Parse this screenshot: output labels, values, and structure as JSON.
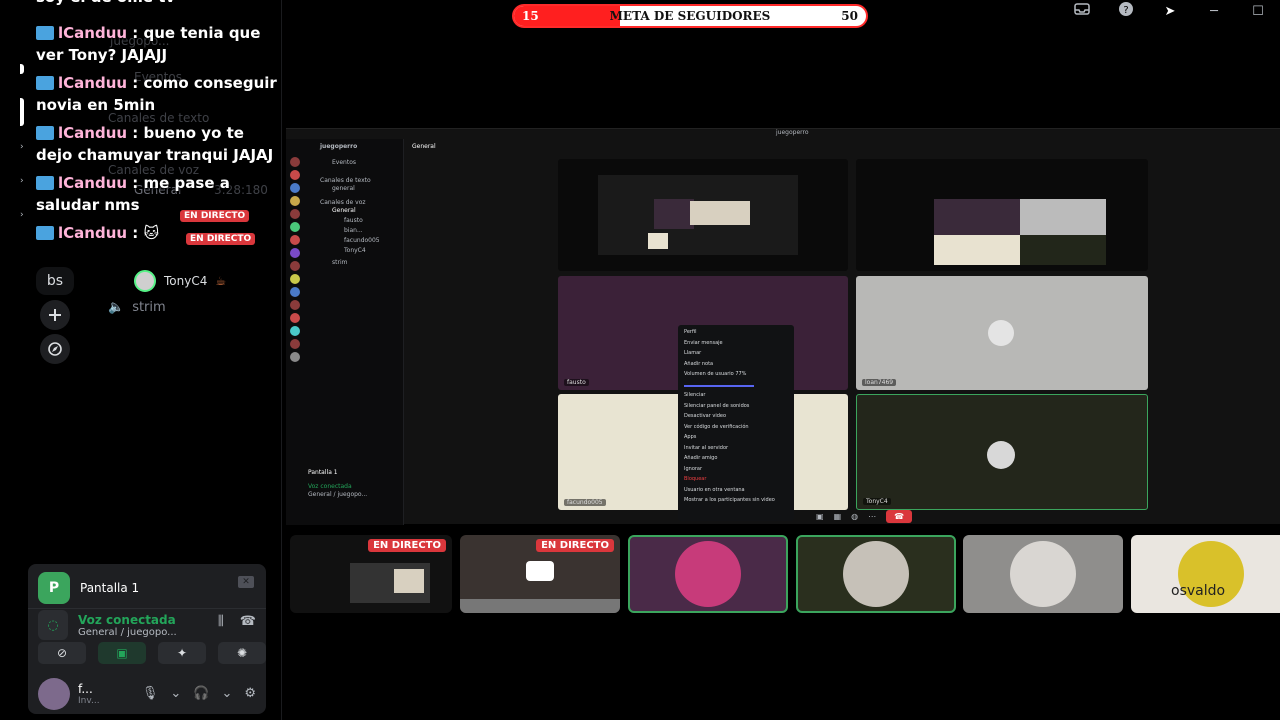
{
  "chat": {
    "partial_top": "soy el de ome tv",
    "messages": [
      {
        "user": "lCanduu",
        "text": ": que tenia que ver Tony? JAJAJJ"
      },
      {
        "user": "lCanduu",
        "text": ": como conseguir novia en 5min"
      },
      {
        "user": "lCanduu",
        "text": ": bueno yo te dejo chamuyar tranqui JAJAJ"
      },
      {
        "user": "lCanduu",
        "text": ": me pase a saludar nms"
      },
      {
        "user": "lCanduu",
        "text": ":"
      }
    ]
  },
  "goal": {
    "label": "META DE SEGUIDORES",
    "current": "15",
    "target": "50",
    "progress": 0.3,
    "fill_color": "#ff1f1f"
  },
  "rail": {
    "server_abbrev": "bs",
    "add_icon": "plus-icon",
    "discover_icon": "compass-icon"
  },
  "channels": {
    "ghost_server": "juegopo...",
    "ghost_events": "Eventos",
    "ghost_text": "Canales de texto",
    "ghost_voice": "Canales de voz",
    "ghost_general": "General",
    "ghost_time": "3:28:180",
    "live_label": "EN DIRECTO",
    "user_tony": "TonyC4",
    "voice_strim": "strim"
  },
  "window": {
    "inbox_icon": "inbox-icon",
    "help_icon": "help-icon",
    "minimize": "─",
    "maximize": "☐"
  },
  "stage": {
    "mini_server": "juegoperro",
    "mini_channel": "General",
    "mini_events": "Eventos",
    "mini_text_header": "Canales de texto",
    "mini_general": "general",
    "mini_voice_header": "Canales de voz",
    "mini_voice_general": "General",
    "mini_users": [
      "fausto",
      "bian...",
      "facundo005",
      "TonyC4"
    ],
    "mini_strim": "strim",
    "mini_panel": "Pantalla 1",
    "mini_vc": "Voz conectada",
    "mini_vc_sub": "General / juegopo...",
    "tile_names": [
      "fausto",
      "loan7469",
      "facundo005",
      "TonyC4"
    ],
    "context_menu": [
      "Perfil",
      "Enviar mensaje",
      "Llamar",
      "Añadir nota",
      "Volumen de usuario",
      "Silenciar",
      "Silenciar panel de sonidos",
      "Desactivar video",
      "Ver código de verificación",
      "Apps",
      "Invitar al servidor",
      "Añadir amigo",
      "Ignorar",
      "Bloquear",
      "Usuario en otra ventana",
      "Mostrar a los participantes sin video"
    ],
    "volume_value": "77%"
  },
  "strip": {
    "live_label": "EN DIRECTO",
    "tile_text_osvaldo": "osvaldo"
  },
  "panel": {
    "screen": "Pantalla 1",
    "screen_avatar": "P",
    "voice_status": "Voz conectada",
    "voice_channel": "General / juegopo...",
    "username": "f...",
    "user_status": "Inv..."
  }
}
